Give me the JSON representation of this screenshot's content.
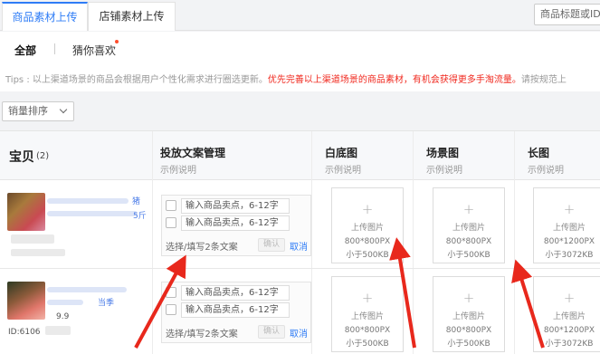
{
  "tabs": [
    {
      "label": "商品素材上传",
      "active": true
    },
    {
      "label": "店铺素材上传",
      "active": false
    }
  ],
  "search": {
    "placeholder": "商品标题或ID"
  },
  "filters": {
    "all": "全部",
    "guess": "猜你喜欢"
  },
  "tips": {
    "prefix": "Tips : 以上渠道场景的商品会根据用户个性化需求进行圈选更新。",
    "highlight": "优先完善以上渠道场景的商品素材，有机会获得更多手淘流量。",
    "suffix": "请按规范上"
  },
  "sort": {
    "label": "销量排序"
  },
  "table": {
    "columns": [
      {
        "title": "宝贝",
        "count": "(2)",
        "sub": ""
      },
      {
        "title": "投放文案管理",
        "sub": "示例说明"
      },
      {
        "title": "白底图",
        "sub": "示例说明"
      },
      {
        "title": "场景图",
        "sub": "示例说明"
      },
      {
        "title": "长图",
        "sub": "示例说明"
      }
    ],
    "rows": [
      {
        "product_fragments": [
          "猪",
          "5斤"
        ],
        "copy": {
          "inputs": [
            "输入商品卖点，6-12字",
            "输入商品卖点，6-12字"
          ],
          "hint": "选择/填写2条文案",
          "confirm": "确认",
          "cancel": "取消"
        },
        "uploads": [
          {
            "label": "上传图片",
            "size": "800*800PX",
            "limit": "小于500KB"
          },
          {
            "label": "上传图片",
            "size": "800*800PX",
            "limit": "小于500KB"
          },
          {
            "label": "上传图片",
            "size": "800*1200PX",
            "limit": "小于3072KB"
          }
        ]
      },
      {
        "product_fragments": [
          "9.9",
          "ID:6106",
          "当季"
        ],
        "copy": {
          "inputs": [
            "输入商品卖点，6-12字",
            "输入商品卖点，6-12字"
          ],
          "hint": "选择/填写2条文案",
          "confirm": "确认",
          "cancel": "取消"
        },
        "uploads": [
          {
            "label": "上传图片",
            "size": "800*800PX",
            "limit": "小于500KB"
          },
          {
            "label": "上传图片",
            "size": "800*800PX",
            "limit": "小于500KB"
          },
          {
            "label": "上传图片",
            "size": "800*1200PX",
            "limit": "小于3072KB"
          }
        ]
      }
    ]
  },
  "colors": {
    "accent": "#2e7cf6",
    "highlight": "#f0281e",
    "arrow": "#e8281c"
  }
}
